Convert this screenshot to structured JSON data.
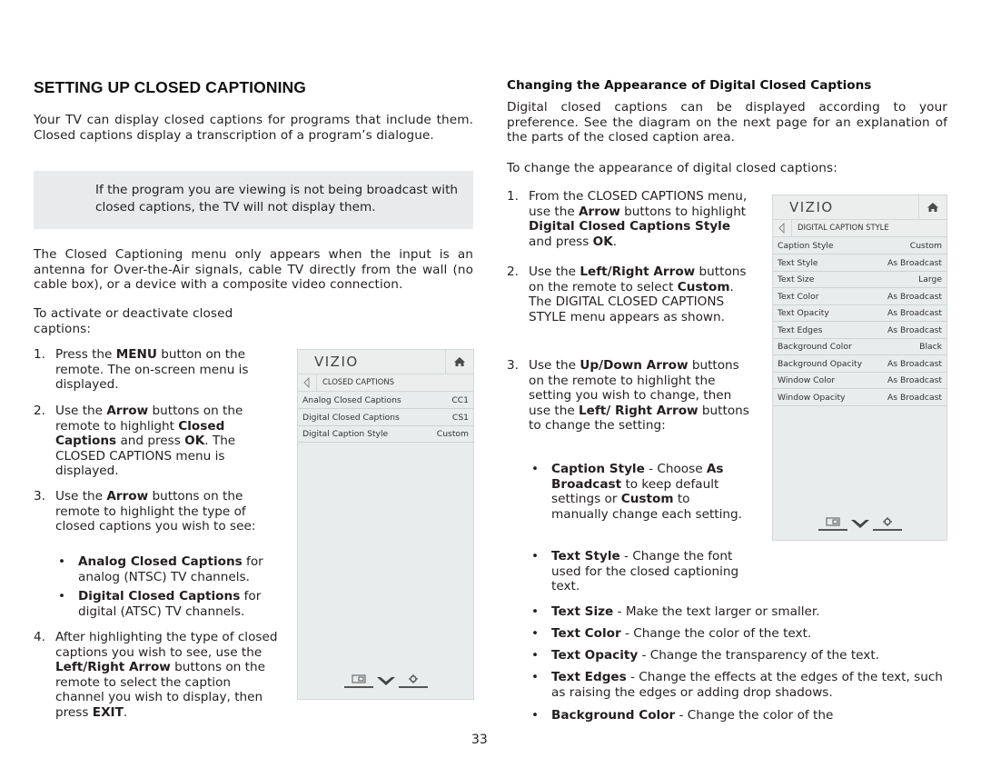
{
  "left": {
    "heading": "SETTING UP CLOSED CAPTIONING",
    "intro": "Your TV can display closed captions for programs that include them. Closed captions display a transcription of a program’s dialogue.",
    "note": "If the program you are viewing is not being broadcast with closed captions, the TV will not display them.",
    "menu_info": "The Closed Captioning menu only appears when the input is an antenna for Over-the-Air signals, cable TV directly from the wall (no cable box), or a device with a composite video connection.",
    "activate_intro": "To activate or deactivate closed captions:",
    "steps": [
      {
        "num": "1.",
        "parts": [
          "Press the ",
          "MENU",
          " button on the remote. The on-screen menu is displayed."
        ]
      },
      {
        "num": "2.",
        "parts": [
          "Use the ",
          "Arrow",
          " buttons on the remote to highlight ",
          "Closed Captions",
          " and press ",
          "OK",
          ". The CLOSED CAPTIONS menu is displayed."
        ]
      },
      {
        "num": "3.",
        "parts": [
          "Use the ",
          "Arrow",
          " buttons on the remote to highlight the type of closed captions you wish to see:"
        ]
      },
      {
        "num": "4.",
        "parts": [
          "After highlighting the type of closed captions you wish to see, use the ",
          "Left/Right Arrow",
          " buttons on the remote to select the caption channel you wish to display, then press ",
          "EXIT",
          "."
        ]
      }
    ],
    "step3_bullets": [
      {
        "bold": "Analog Closed Captions",
        "text": " for analog (NTSC) TV channels."
      },
      {
        "bold": "Digital Closed Captions",
        "text": " for digital (ATSC) TV channels."
      }
    ],
    "menu": {
      "logo": "VIZIO",
      "title": "CLOSED CAPTIONS",
      "rows": [
        {
          "label": "Analog Closed Captions",
          "value": "CC1"
        },
        {
          "label": "Digital Closed Captions",
          "value": "CS1"
        },
        {
          "label": "Digital Caption Style",
          "value": "Custom"
        }
      ]
    }
  },
  "right": {
    "heading": "Changing the Appearance of Digital Closed Captions",
    "intro": "Digital closed captions can be displayed according to your preference. See the diagram on the next page for an explanation of the parts of the closed caption area.",
    "change_intro": "To change the appearance of digital closed captions:",
    "steps": [
      {
        "num": "1.",
        "parts": [
          "From the CLOSED CAPTIONS menu, use the ",
          "Arrow",
          " buttons to highlight ",
          "Digital Closed Captions Style",
          " and press ",
          "OK",
          "."
        ]
      },
      {
        "num": "2.",
        "parts": [
          "Use the ",
          "Left/Right Arrow",
          " buttons on the remote to select ",
          "Custom",
          ". The DIGITAL CLOSED CAPTIONS STYLE menu appears as shown."
        ]
      },
      {
        "num": "3.",
        "parts": [
          "Use the ",
          "Up/Down Arrow",
          " buttons on the remote to highlight the setting you wish to change, then use the ",
          "Left/ Right Arrow",
          " buttons to change the setting:"
        ]
      }
    ],
    "bullets_narrow": [
      {
        "bold": "Caption Style",
        "parts": [
          " - Choose ",
          "As Broadcast",
          " to keep default settings or ",
          "Custom",
          " to manually change each setting."
        ]
      },
      {
        "bold": "Text Style",
        "parts": [
          "  - Change the font used for the closed captioning text."
        ]
      }
    ],
    "bullets_wide": [
      {
        "bold": "Text Size",
        "text": " - Make the text larger or smaller."
      },
      {
        "bold": "Text Color",
        "text": " - Change the color of the text."
      },
      {
        "bold": "Text Opacity",
        "text": " - Change the transparency of the text."
      },
      {
        "bold": "Text Edges",
        "text": " - Change the effects at the edges of the text, such as raising the edges or adding drop shadows."
      },
      {
        "bold": "Background Color",
        "text": " - Change the color of the"
      }
    ],
    "menu": {
      "logo": "VIZIO",
      "title": "DIGITAL CAPTION STYLE",
      "rows": [
        {
          "label": "Caption Style",
          "value": "Custom"
        },
        {
          "label": "Text Style",
          "value": "As Broadcast"
        },
        {
          "label": "Text Size",
          "value": "Large"
        },
        {
          "label": "Text Color",
          "value": "As Broadcast"
        },
        {
          "label": "Text Opacity",
          "value": "As Broadcast"
        },
        {
          "label": "Text Edges",
          "value": "As Broadcast"
        },
        {
          "label": "Background Color",
          "value": "Black"
        },
        {
          "label": "Background Opacity",
          "value": "As Broadcast"
        },
        {
          "label": "Window Color",
          "value": "As Broadcast"
        },
        {
          "label": "Window Opacity",
          "value": "As Broadcast"
        }
      ]
    }
  },
  "footer": {
    "page_number": "33"
  },
  "icons": {
    "home": "home-icon",
    "back": "back-arrow-icon",
    "wide": "wide-screen-icon",
    "chevron": "chevron-down-icon",
    "settings": "gear-icon"
  }
}
